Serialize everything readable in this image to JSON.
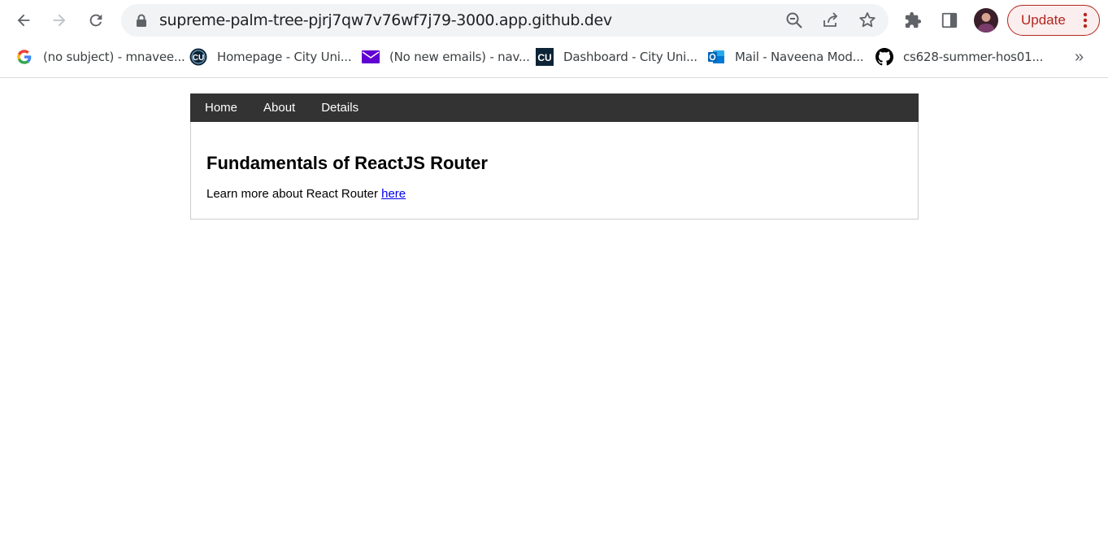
{
  "browser": {
    "url": "supreme-palm-tree-pjrj7qw7v76wf7j79-3000.app.github.dev",
    "update_label": "Update",
    "accent_color": "#b3261e"
  },
  "bookmarks": [
    {
      "label": "(no subject) - mnavee...",
      "icon": "google-icon"
    },
    {
      "label": "Homepage - City Uni...",
      "icon": "cu-round-icon"
    },
    {
      "label": "(No new emails) - nav...",
      "icon": "mail-icon"
    },
    {
      "label": "Dashboard - City Uni...",
      "icon": "cu-square-icon"
    },
    {
      "label": "Mail - Naveena Mod...",
      "icon": "outlook-icon"
    },
    {
      "label": "cs628-summer-hos01...",
      "icon": "github-icon"
    }
  ],
  "bookmarks_more": "»",
  "nav": {
    "items": [
      "Home",
      "About",
      "Details"
    ]
  },
  "main": {
    "heading": "Fundamentals of ReactJS Router",
    "text": "Learn more about React Router",
    "link_label": "here"
  }
}
